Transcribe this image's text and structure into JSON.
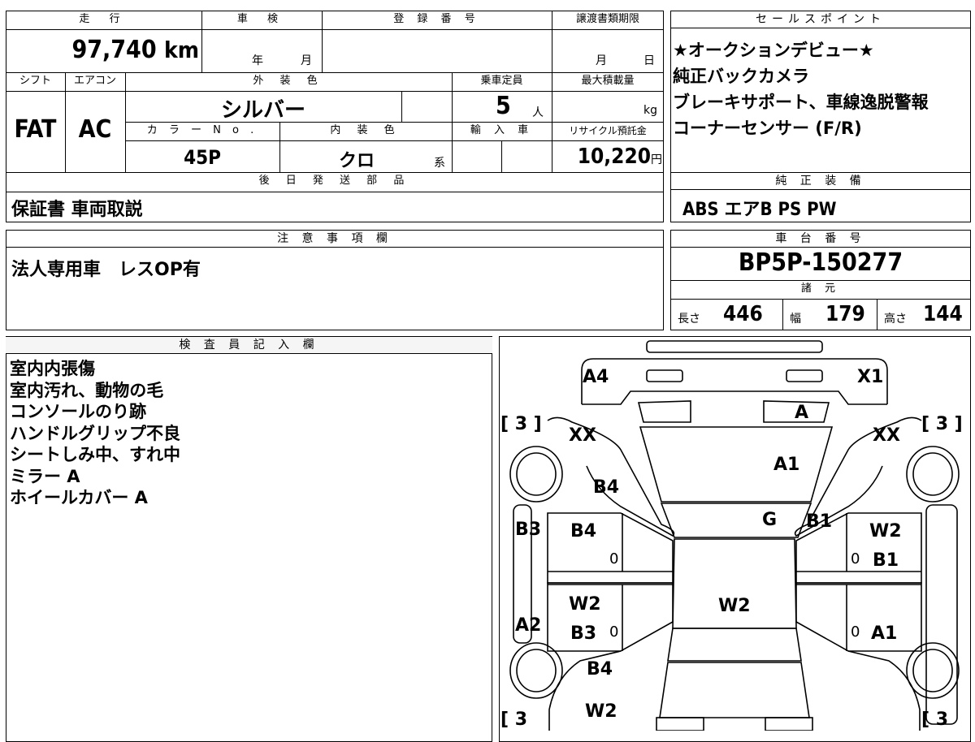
{
  "vehicle": {
    "headers": {
      "mileage": "走 行",
      "inspection": "車 検",
      "registration": "登 録 番 号",
      "transfer_deadline": "譲渡書類期限",
      "shift": "シフト",
      "aircon": "エアコン",
      "exterior_color": "外 装 色",
      "capacity": "乗車定員",
      "max_load": "最大積載量",
      "color_no": "カ ラ ー N o .",
      "interior_color": "内 装 色",
      "import": "輸 入 車",
      "recycle_fee": "リサイクル預託金",
      "later_parts": "後 日 発 送 部 品"
    },
    "mileage": "97,740",
    "mileage_unit": "km",
    "inspection_year_unit": "年",
    "inspection_month_unit": "月",
    "transfer_month_unit": "月",
    "transfer_day_unit": "日",
    "shift": "FAT",
    "aircon": "AC",
    "exterior_color": "シルバー",
    "capacity": "5",
    "capacity_unit": "人",
    "max_load_unit": "kg",
    "color_no": "45P",
    "interior_color": "クロ",
    "interior_suffix": "系",
    "recycle_fee": "10,220",
    "recycle_unit": "円",
    "later_parts": "保証書 車両取説"
  },
  "sales_points": {
    "header": "セールスポイント",
    "lines": [
      "★オークションデビュー★",
      "純正バックカメラ",
      "ブレーキサポート、車線逸脱警報",
      "コーナーセンサー (F/R)"
    ]
  },
  "equipment": {
    "header": "純 正 装 備",
    "value": "ABS エアB PS PW"
  },
  "notes": {
    "header": "注 意 事 項 欄",
    "value": "法人専用車　レスOP有"
  },
  "chassis": {
    "header": "車 台 番 号",
    "value": "BP5P-150277"
  },
  "specs": {
    "header": "諸 元",
    "length_label": "長さ",
    "length": "446",
    "width_label": "幅",
    "width": "179",
    "height_label": "高さ",
    "height": "144"
  },
  "inspector": {
    "header": "検 査 員 記 入 欄",
    "lines": [
      "室内内張傷",
      "室内汚れ、動物の毛",
      "コンソールのり跡",
      "ハンドルグリップ不良",
      "シートしみ中、すれ中",
      "ミラー A",
      "ホイールカバー A"
    ]
  },
  "diagram": {
    "marks": {
      "a4": "A4",
      "x1": "X1",
      "a_top": "A",
      "xx_left": "XX",
      "xx_right": "XX",
      "a1_hood": "A1",
      "b4_left_fender": "B4",
      "b3_left": "B3",
      "b4_left_door": "B4",
      "g": "G",
      "b1_top": "B1",
      "w2_right_door": "W2",
      "b1_right_door": "B1",
      "w2_left_rear": "W2",
      "w2_roof": "W2",
      "a2_left": "A2",
      "b3_left_rear": "B3",
      "a1_right_rear": "A1",
      "b4_left_quarter": "B4",
      "w2_bottom": "W2",
      "tire_left_front": "[ 3 ]",
      "tire_right_front": "[ 3 ]",
      "tire_left_rear": "[ 3",
      "tire_right_rear": "[ 3",
      "zero_1": "0",
      "zero_2": "0",
      "zero_3": "0",
      "zero_4": "0"
    }
  }
}
